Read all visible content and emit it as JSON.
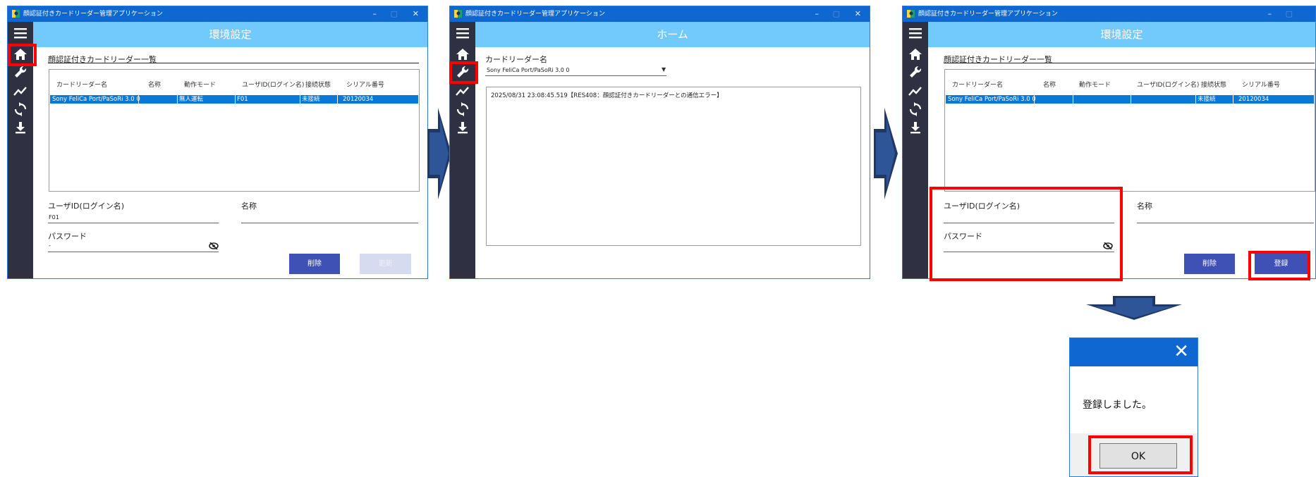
{
  "window_title": "顔認証付きカードリーダー管理アプリケーション",
  "window_controls": {
    "minimize": "–",
    "maximize": "▢",
    "close": "✕"
  },
  "colors": {
    "accent_blue": "#0f67d1",
    "header_sky": "#72c9fb",
    "sidebar_dark": "#2f3142",
    "button_indigo": "#3f51b5",
    "highlight_red": "#ff0000"
  },
  "sidebar_icons": [
    "menu-icon",
    "home-icon",
    "wrench-icon",
    "chart-line-icon",
    "sync-icon",
    "download-icon"
  ],
  "screen1": {
    "header_title": "環境設定",
    "section_title": "顔認証付きカードリーダー一覧",
    "columns": [
      "カードリーダー名",
      "名称",
      "動作モード",
      "ユーザID(ログイン名)",
      "接続状態",
      "シリアル番号"
    ],
    "row": [
      "Sony FeliCa Port/PaSoRi 3.0 0",
      "",
      "無人運転",
      "F01",
      "未接続",
      "20120034"
    ],
    "user_id_label": "ユーザID(ログイン名)",
    "user_id_value": "F01",
    "name_label": "名称",
    "password_label": "パスワード",
    "password_value": "-",
    "delete_button": "削除",
    "update_button": "更新"
  },
  "screen2": {
    "header_title": "ホーム",
    "reader_label": "カードリーダー名",
    "reader_selected": "Sony FeliCa Port/PaSoRi 3.0 0",
    "log_line": "2025/08/31 23:08:45.519【RES408：顔認証付きカードリーダーとの通信エラー】"
  },
  "screen3": {
    "header_title": "環境設定",
    "section_title": "顔認証付きカードリーダー一覧",
    "columns": [
      "カードリーダー名",
      "名称",
      "動作モード",
      "ユーザID(ログイン名)",
      "接続状態",
      "シリアル番号"
    ],
    "row": [
      "Sony FeliCa Port/PaSoRi 3.0 0",
      "",
      "",
      "",
      "未接続",
      "20120034"
    ],
    "user_id_label": "ユーザID(ログイン名)",
    "name_label": "名称",
    "password_label": "パスワード",
    "delete_button": "削除",
    "register_button": "登録"
  },
  "dialog": {
    "close": "✕",
    "message": "登録しました。",
    "ok_button": "OK"
  }
}
